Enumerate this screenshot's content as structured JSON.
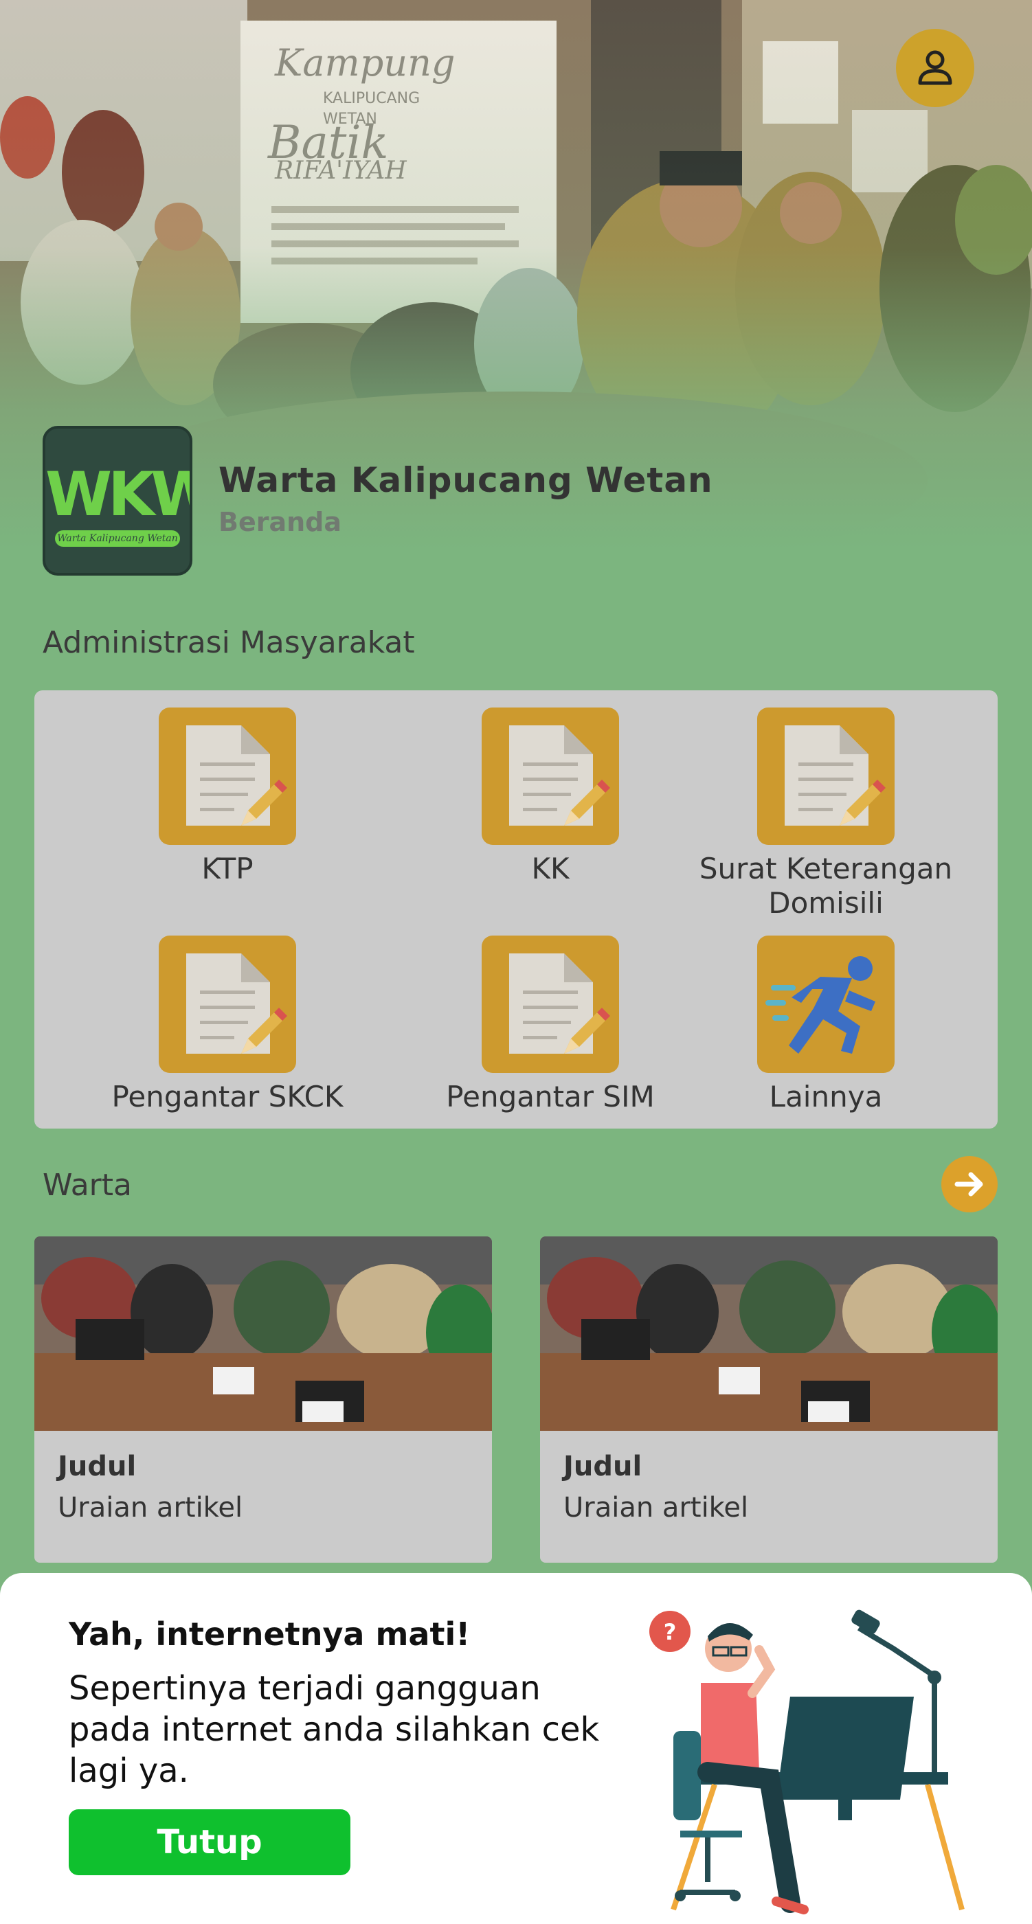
{
  "header": {
    "title": "Warta Kalipucang Wetan",
    "subtitle": "Beranda",
    "logo_text": "WKW",
    "logo_tagline": "Warta Kalipucang Wetan",
    "profile_icon": "user-icon"
  },
  "admin": {
    "title": "Administrasi Masyarakat",
    "items": [
      {
        "label": "KTP",
        "icon": "document-edit-icon"
      },
      {
        "label": "KK",
        "icon": "document-edit-icon"
      },
      {
        "label": "Surat Keterangan Domisili",
        "icon": "document-edit-icon"
      },
      {
        "label": "Pengantar SKCK",
        "icon": "document-edit-icon"
      },
      {
        "label": "Pengantar SIM",
        "icon": "document-edit-icon"
      },
      {
        "label": "Lainnya",
        "icon": "running-person-icon"
      }
    ]
  },
  "warta": {
    "title": "Warta",
    "more_icon": "arrow-right-icon",
    "cards": [
      {
        "title": "Judul",
        "desc": "Uraian artikel"
      },
      {
        "title": "Judul",
        "desc": "Uraian artikel"
      }
    ]
  },
  "offline_sheet": {
    "title": "Yah, internetnya mati!",
    "message": "Sepertinya terjadi gangguan pada internet anda silahkan cek lagi ya.",
    "close_label": "Tutup"
  },
  "colors": {
    "background": "#7cb57f",
    "panel": "#cbcbcb",
    "accent": "#cd9a2e",
    "button": "#0fc02e"
  }
}
